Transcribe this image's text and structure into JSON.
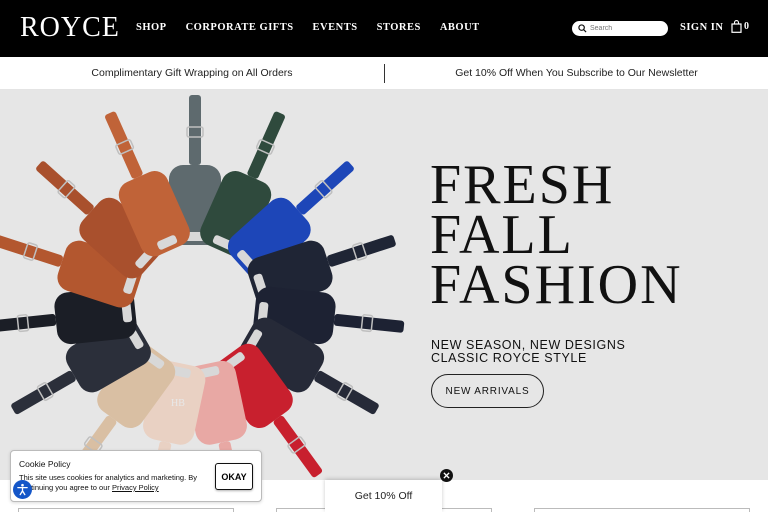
{
  "header": {
    "logo": "ROYCE",
    "nav": [
      "SHOP",
      "CORPORATE GIFTS",
      "EVENTS",
      "STORES",
      "ABOUT"
    ],
    "search_placeholder": "Search",
    "signin_label": "SIGN IN",
    "cart_count": "0"
  },
  "promo": {
    "left": "Complimentary Gift Wrapping on All Orders",
    "right": "Get 10% Off When You Subscribe to Our Newsletter"
  },
  "hero": {
    "title_lines": [
      "FRESH",
      "FALL",
      "FASHION"
    ],
    "subtitle_line1": "NEW SEASON, NEW DESIGNS",
    "subtitle_line2": "CLASSIC ROYCE STYLE",
    "cta_label": "NEW ARRIVALS",
    "monogram": "HB",
    "tag_colors": [
      "#5e6a6e",
      "#2f4a3d",
      "#1d46b8",
      "#1f2535",
      "#1d2233",
      "#262a38",
      "#c8202e",
      "#e8a8a4",
      "#e9d1c3",
      "#d9bfa3",
      "#2b2f3a",
      "#1b1e26",
      "#b3572f",
      "#a9502d",
      "#c06338"
    ]
  },
  "cookie": {
    "title": "Cookie Policy",
    "text": "This site uses cookies for analytics and marketing. By continuing you agree to our",
    "link": "Privacy Policy",
    "ok_label": "OKAY"
  },
  "discount": {
    "label": "Get 10% Off"
  }
}
